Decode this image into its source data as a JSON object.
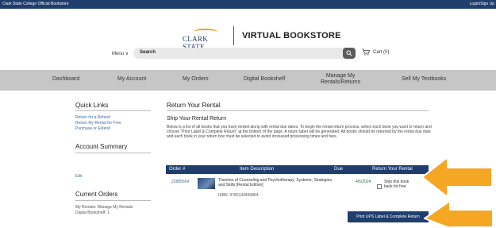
{
  "topbar": {
    "store_name": "Clark State College Official Bookstore",
    "login": "Login/Sign Up"
  },
  "brand": {
    "logo_text": "CLARK STATE",
    "title": "VIRTUAL BOOKSTORE"
  },
  "header": {
    "menu_label": "Menu ∨",
    "search_label": "Search",
    "cart_label": "Cart (0)"
  },
  "nav": {
    "items": [
      {
        "label": "Dashboard"
      },
      {
        "label": "My Account"
      },
      {
        "label": "My Orders"
      },
      {
        "label": "Digital Bookshelf"
      },
      {
        "label_line1": "Manage My",
        "label_line2": "Rentals/Returns"
      },
      {
        "label": "Sell My Textbooks"
      }
    ]
  },
  "sidebar": {
    "quick_links_title": "Quick Links",
    "links": [
      "Return for a Refund",
      "Return My Rental for Free",
      "Purchase or Extend"
    ],
    "account_summary_title": "Account Summary",
    "edit_label": "Edit",
    "current_orders_title": "Current Orders",
    "current_orders_line1": "My Rentals: Manage My Rentals",
    "current_orders_line2": "Digital Bookshelf: 1"
  },
  "main": {
    "title": "Return Your Rental",
    "subtitle": "Ship Your Rental Return",
    "description": "Below is a list of all books that you have rented along with rental due dates. To begin the rental return process, select each book you want to return and choose \"Print Label & Complete Return\" at the bottom of the page. A return label will be generated. All books should be returned by the rental due date and each book in your return box must be selected to avoid increased processing times and fees.",
    "table": {
      "headers": [
        "Order #",
        "Item Description",
        "Due",
        "Return Your Rental"
      ],
      "row": {
        "order": "22885664",
        "description": "Theories of Counseling and Psychotherapy: Systems, Strategies, and Skills [Rental Edition]",
        "isbn": "ISBN: 9780134460864",
        "due": "4/5/2024",
        "ship_label": "Ship this book back for free"
      }
    },
    "print_button": "Print UPS Label & Complete Return"
  },
  "colors": {
    "navy": "#1f3d6d",
    "arrow": "#f5a623",
    "nav_bg": "#c6c6c6",
    "link": "#3a6ea5"
  }
}
